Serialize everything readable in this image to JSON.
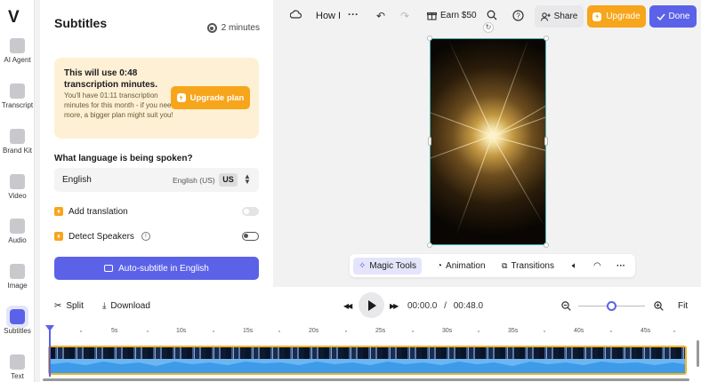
{
  "rail": {
    "logo": "V",
    "items": [
      {
        "label": "AI Agent",
        "icon": "sparkle-icon"
      },
      {
        "label": "Transcript",
        "icon": "transcript-icon"
      },
      {
        "label": "Brand Kit",
        "icon": "brand-kit-icon"
      },
      {
        "label": "Video",
        "icon": "video-icon"
      },
      {
        "label": "Audio",
        "icon": "audio-icon"
      },
      {
        "label": "Image",
        "icon": "image-icon"
      },
      {
        "label": "Subtitles",
        "icon": "subtitles-icon"
      },
      {
        "label": "Text",
        "icon": "text-icon"
      }
    ],
    "active": "Subtitles"
  },
  "panel": {
    "title": "Subtitles",
    "estimate": "2 minutes",
    "notice": {
      "title": "This will use 0:48 transcription minutes.",
      "body": "You'll have 01:11 transcription minutes for this month - if you need more, a bigger plan might suit you!",
      "button": "Upgrade plan"
    },
    "language_question": "What language is being spoken?",
    "language": "English",
    "region": "English (US)",
    "region_code": "US",
    "options": [
      {
        "label": "Add translation",
        "enabled": false
      },
      {
        "label": "Detect Speakers",
        "enabled": false
      }
    ],
    "auto_button": "Auto-subtitle in English"
  },
  "topbar": {
    "project_name": "How I",
    "earn": "Earn $50",
    "share": "Share",
    "upgrade": "Upgrade",
    "done": "Done"
  },
  "tools": {
    "magic": "Magic Tools",
    "animation": "Animation",
    "transitions": "Transitions"
  },
  "timeline": {
    "split": "Split",
    "download": "Download",
    "current_time": "00:00.0",
    "separator": "/",
    "total_time": "00:48.0",
    "zoom_level": 0.45,
    "fit": "Fit",
    "ticks": [
      "5s",
      "10s",
      "15s",
      "20s",
      "25s",
      "30s",
      "35s",
      "40s",
      "45s"
    ]
  },
  "colors": {
    "accent": "#5b62e8",
    "upgrade": "#f7a51b",
    "notice_bg": "#fdf0d4",
    "clip_border": "#f0b429",
    "waveform": "#3d9be9"
  }
}
